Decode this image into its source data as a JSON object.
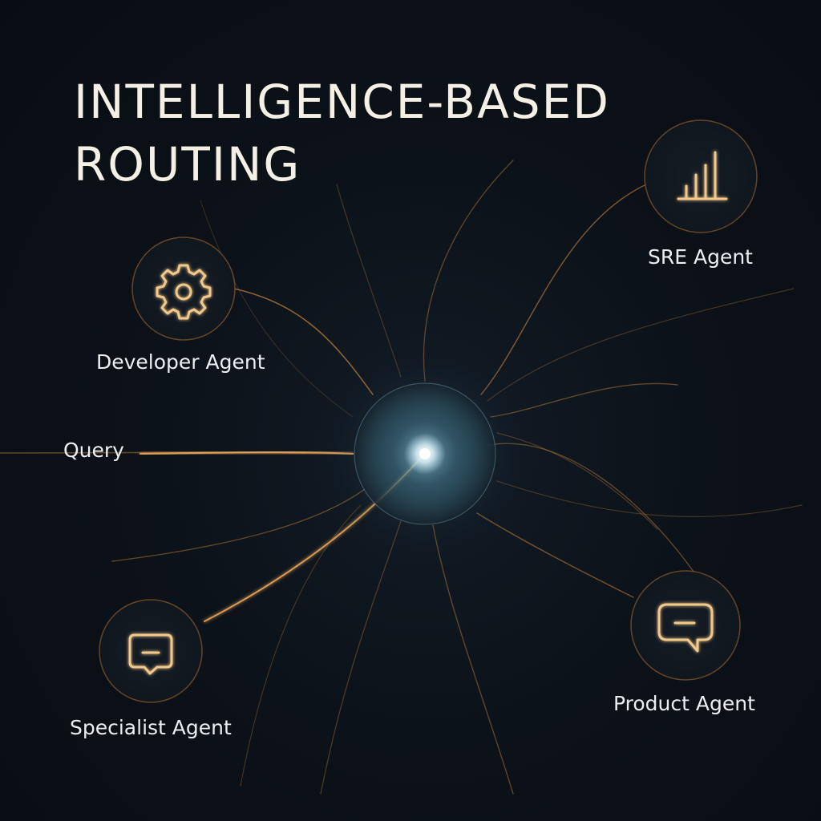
{
  "title": {
    "line1": "INTELLIGENCE-BASED",
    "line2": "ROUTING"
  },
  "input": {
    "label": "Query"
  },
  "hub": {
    "icon": "glowing-orb"
  },
  "agents": {
    "developer": {
      "label": "Developer Agent",
      "icon": "gear-icon"
    },
    "sre": {
      "label": "SRE Agent",
      "icon": "bar-chart-icon"
    },
    "specialist": {
      "label": "Specialist Agent",
      "icon": "chat-bubble-icon"
    },
    "product": {
      "label": "Product Agent",
      "icon": "speech-bubble-icon"
    }
  },
  "colors": {
    "background": "#0b1118",
    "connection": "#c8843f",
    "hub_glow": "#8fd4ee",
    "text": "#eef1f4"
  }
}
